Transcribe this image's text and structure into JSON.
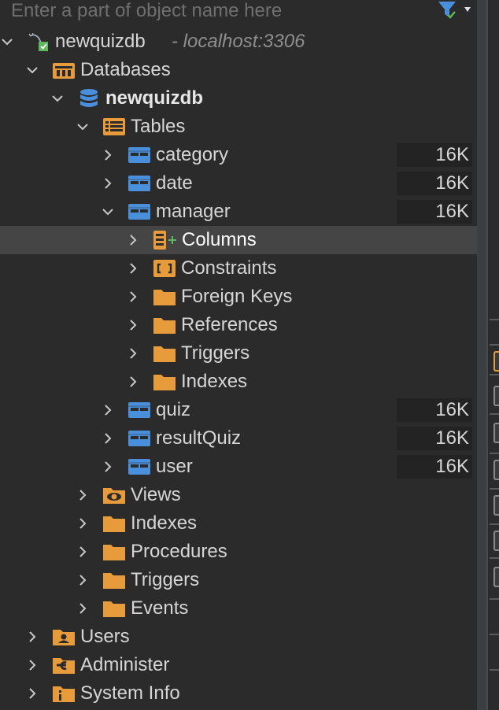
{
  "search": {
    "placeholder": "Enter a part of object name here"
  },
  "colors": {
    "folder": "#e89b3a",
    "table": "#4a8fdc",
    "background": "#2b2b2b",
    "selected": "#454545"
  },
  "tree": [
    {
      "level": 0,
      "expanded": true,
      "icon": "mysql-dolphin-icon",
      "label": "newquizdb",
      "sublabel": "- localhost:3306"
    },
    {
      "level": 1,
      "expanded": true,
      "icon": "databases-icon",
      "label": "Databases"
    },
    {
      "level": 2,
      "expanded": true,
      "icon": "database-icon",
      "label": "newquizdb",
      "bold": true
    },
    {
      "level": 3,
      "expanded": true,
      "icon": "tables-icon",
      "label": "Tables"
    },
    {
      "level": 4,
      "expanded": false,
      "icon": "table-icon",
      "label": "category",
      "size": "16K"
    },
    {
      "level": 4,
      "expanded": false,
      "icon": "table-icon",
      "label": "date",
      "size": "16K"
    },
    {
      "level": 4,
      "expanded": true,
      "icon": "table-icon",
      "label": "manager",
      "size": "16K"
    },
    {
      "level": 5,
      "expanded": false,
      "icon": "columns-icon",
      "label": "Columns",
      "selected": true
    },
    {
      "level": 5,
      "expanded": false,
      "icon": "constraints-icon",
      "label": "Constraints"
    },
    {
      "level": 5,
      "expanded": false,
      "icon": "folder-icon",
      "label": "Foreign Keys"
    },
    {
      "level": 5,
      "expanded": false,
      "icon": "folder-icon",
      "label": "References"
    },
    {
      "level": 5,
      "expanded": false,
      "icon": "folder-icon",
      "label": "Triggers"
    },
    {
      "level": 5,
      "expanded": false,
      "icon": "folder-icon",
      "label": "Indexes"
    },
    {
      "level": 4,
      "expanded": false,
      "icon": "table-icon",
      "label": "quiz",
      "size": "16K"
    },
    {
      "level": 4,
      "expanded": false,
      "icon": "table-icon",
      "label": "resultQuiz",
      "size": "16K"
    },
    {
      "level": 4,
      "expanded": false,
      "icon": "table-icon",
      "label": "user",
      "size": "16K"
    },
    {
      "level": 3,
      "expanded": false,
      "icon": "views-icon",
      "label": "Views"
    },
    {
      "level": 3,
      "expanded": false,
      "icon": "folder-icon",
      "label": "Indexes"
    },
    {
      "level": 3,
      "expanded": false,
      "icon": "folder-icon",
      "label": "Procedures"
    },
    {
      "level": 3,
      "expanded": false,
      "icon": "folder-icon",
      "label": "Triggers"
    },
    {
      "level": 3,
      "expanded": false,
      "icon": "folder-icon",
      "label": "Events"
    },
    {
      "level": 1,
      "expanded": false,
      "icon": "users-icon",
      "label": "Users"
    },
    {
      "level": 1,
      "expanded": false,
      "icon": "administer-icon",
      "label": "Administer"
    },
    {
      "level": 1,
      "expanded": false,
      "icon": "system-info-icon",
      "label": "System Info"
    }
  ]
}
